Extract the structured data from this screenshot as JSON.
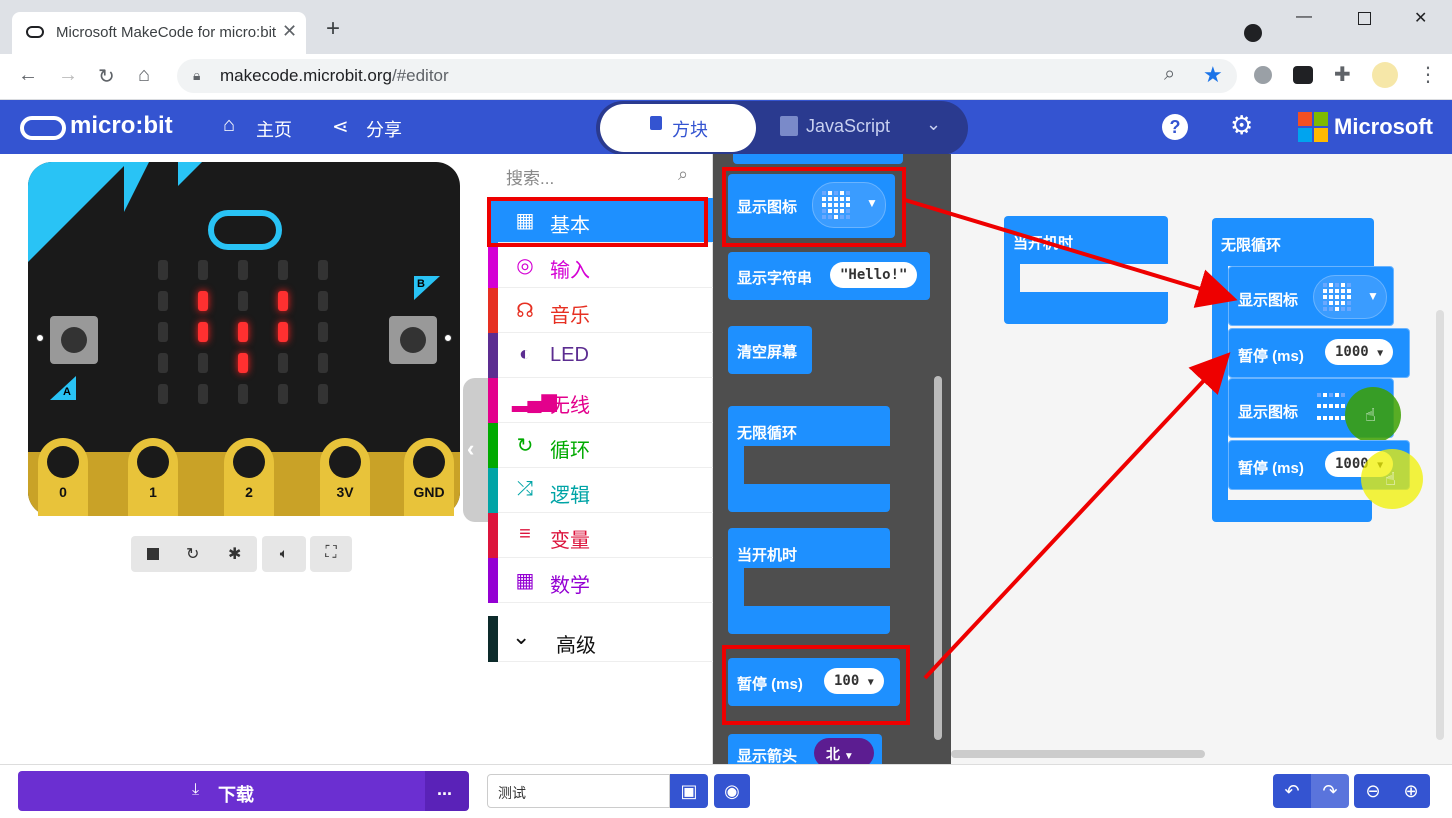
{
  "browser": {
    "tab_title": "Microsoft MakeCode for micro:bit",
    "tab_close": "✕",
    "new_tab": "+",
    "url_host": "makecode.microbit.org",
    "url_path": "/#editor"
  },
  "header": {
    "logo": "micro:bit",
    "home": "主页",
    "share": "分享",
    "blocks": "方块",
    "javascript": "JavaScript",
    "microsoft": "Microsoft"
  },
  "board": {
    "pins": [
      "0",
      "1",
      "2",
      "3V",
      "GND"
    ],
    "button_a": "A",
    "button_b": "B"
  },
  "toolbox": {
    "search_placeholder": "搜索...",
    "categories": [
      {
        "label": "基本",
        "color": "#1e90ff",
        "icon": "grid-icon"
      },
      {
        "label": "输入",
        "color": "#d400d4",
        "icon": "target-icon"
      },
      {
        "label": "音乐",
        "color": "#e63022",
        "icon": "headphones-icon"
      },
      {
        "label": "LED",
        "color": "#5c2d91",
        "icon": "toggle-icon"
      },
      {
        "label": "无线",
        "color": "#e3008c",
        "icon": "signal-icon"
      },
      {
        "label": "循环",
        "color": "#00aa00",
        "icon": "refresh-icon"
      },
      {
        "label": "逻辑",
        "color": "#00a4a6",
        "icon": "shuffle-icon"
      },
      {
        "label": "变量",
        "color": "#dc143c",
        "icon": "list-icon"
      },
      {
        "label": "数学",
        "color": "#9400d3",
        "icon": "calculator-icon"
      }
    ],
    "advanced": "高级"
  },
  "flyout": {
    "show_icon": "显示图标",
    "show_string": "显示字符串",
    "string_value": "\"Hello!\"",
    "clear_screen": "清空屏幕",
    "forever": "无限循环",
    "on_start": "当开机时",
    "pause": "暂停 (ms)",
    "pause_value": "100",
    "show_arrow": "显示箭头",
    "arrow_value": "北"
  },
  "workspace": {
    "on_start": "当开机时",
    "forever": "无限循环",
    "show_icon_1": "显示图标",
    "pause_1": "暂停 (ms)",
    "pause_1_value": "1000",
    "show_icon_2": "显示图标",
    "pause_2": "暂停 (ms)",
    "pause_2_value": "1000"
  },
  "bottom": {
    "download": "下载",
    "more": "...",
    "project_name": "测试"
  },
  "colors": {
    "header_blue": "#3454d1",
    "block_blue": "#1e90ff",
    "download_purple": "#6b2fd1",
    "highlight_red": "#e00000"
  }
}
